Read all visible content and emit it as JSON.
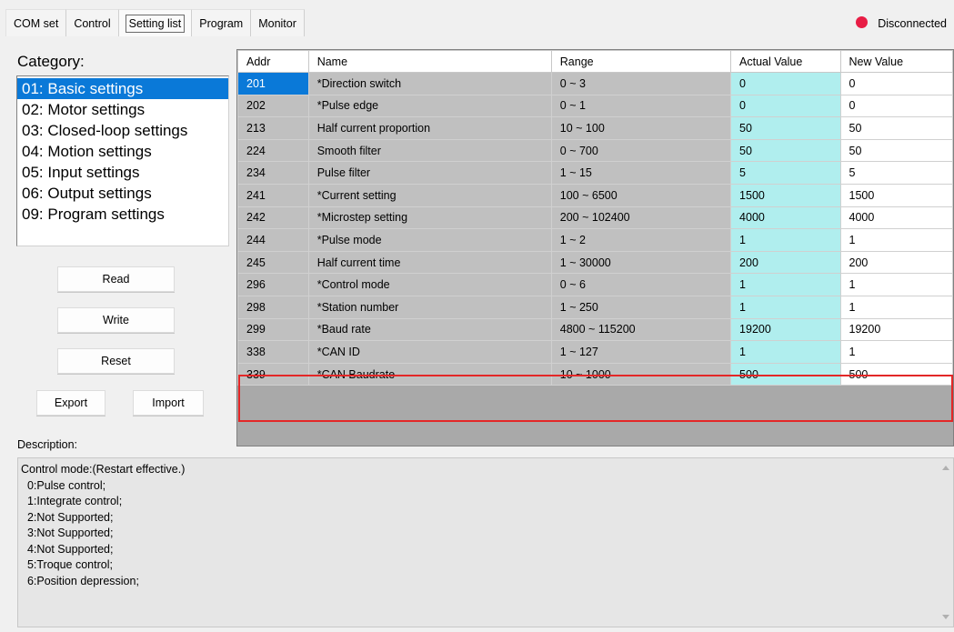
{
  "tabs": [
    {
      "label": "COM set",
      "active": false
    },
    {
      "label": "Control",
      "active": false
    },
    {
      "label": "Setting list",
      "active": true
    },
    {
      "label": "Program",
      "active": false
    },
    {
      "label": "Monitor",
      "active": false
    }
  ],
  "connection": {
    "status": "Disconnected",
    "color": "#e81d45"
  },
  "category": {
    "title": "Category:",
    "items": [
      "01: Basic settings",
      "02: Motor settings",
      "03: Closed-loop settings",
      "04: Motion settings",
      "05: Input settings",
      "06: Output settings",
      "09: Program settings"
    ],
    "selected_index": 0
  },
  "buttons": {
    "read": "Read",
    "write": "Write",
    "reset": "Reset",
    "export": "Export",
    "import": "Import"
  },
  "table": {
    "columns": [
      "Addr",
      "Name",
      "Range",
      "Actual Value",
      "New Value"
    ],
    "rows": [
      {
        "addr": "201",
        "name": "*Direction switch",
        "range": "0 ~ 3",
        "actual": "0",
        "new": "0"
      },
      {
        "addr": "202",
        "name": "*Pulse edge",
        "range": "0 ~ 1",
        "actual": "0",
        "new": "0"
      },
      {
        "addr": "213",
        "name": "Half current proportion",
        "range": "10 ~ 100",
        "actual": "50",
        "new": "50"
      },
      {
        "addr": "224",
        "name": "Smooth filter",
        "range": "0 ~ 700",
        "actual": "50",
        "new": "50"
      },
      {
        "addr": "234",
        "name": "Pulse filter",
        "range": "1 ~ 15",
        "actual": "5",
        "new": "5"
      },
      {
        "addr": "241",
        "name": "*Current setting",
        "range": "100 ~ 6500",
        "actual": "1500",
        "new": "1500"
      },
      {
        "addr": "242",
        "name": "*Microstep setting",
        "range": "200 ~ 102400",
        "actual": "4000",
        "new": "4000"
      },
      {
        "addr": "244",
        "name": "*Pulse mode",
        "range": "1 ~ 2",
        "actual": "1",
        "new": "1"
      },
      {
        "addr": "245",
        "name": "Half current time",
        "range": "1 ~ 30000",
        "actual": "200",
        "new": "200"
      },
      {
        "addr": "296",
        "name": "*Control mode",
        "range": "0 ~ 6",
        "actual": "1",
        "new": "1"
      },
      {
        "addr": "298",
        "name": "*Station number",
        "range": "1 ~ 250",
        "actual": "1",
        "new": "1"
      },
      {
        "addr": "299",
        "name": "*Baud rate",
        "range": "4800 ~ 115200",
        "actual": "19200",
        "new": "19200"
      },
      {
        "addr": "338",
        "name": "*CAN ID",
        "range": "1 ~ 127",
        "actual": "1",
        "new": "1"
      },
      {
        "addr": "339",
        "name": "*CAN Baudrate",
        "range": "10 ~ 1000",
        "actual": "500",
        "new": "500"
      }
    ],
    "selected_row": 0,
    "highlight_color": "#e32727"
  },
  "description": {
    "label": "Description:",
    "lines": [
      "Control mode:(Restart effective.)",
      "  0:Pulse control;",
      "  1:Integrate control;",
      "  2:Not Supported;",
      "  3:Not Supported;",
      "  4:Not Supported;",
      "  5:Troque control;",
      "  6:Position depression;"
    ]
  }
}
